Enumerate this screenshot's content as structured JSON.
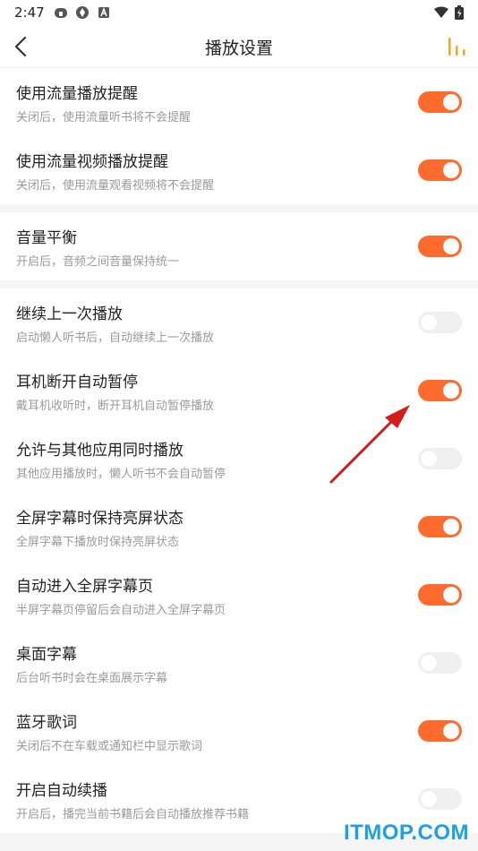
{
  "status_bar": {
    "time": "2:47",
    "left_icons": [
      "app-icon",
      "sync-icon",
      "a-badge-icon"
    ],
    "right_icons": [
      "wifi-icon",
      "battery-icon"
    ]
  },
  "header": {
    "title": "播放设置",
    "back_icon": "chevron-left-icon",
    "right_icon": "equalizer-icon"
  },
  "colors": {
    "accent": "#ff6b2c",
    "toggle_off": "#f0f0f0",
    "annotation_arrow": "#d41c1c"
  },
  "groups": [
    {
      "items": [
        {
          "title": "使用流量播放提醒",
          "subtitle": "关闭后，使用流量听书将不会提醒",
          "enabled": true
        },
        {
          "title": "使用流量视频播放提醒",
          "subtitle": "关闭后，使用流量观看视频将不会提醒",
          "enabled": true
        }
      ]
    },
    {
      "items": [
        {
          "title": "音量平衡",
          "subtitle": "开启后，音频之间音量保持统一",
          "enabled": true
        }
      ]
    },
    {
      "items": [
        {
          "title": "继续上一次播放",
          "subtitle": "启动懒人听书后，自动继续上一次播放",
          "enabled": false
        },
        {
          "title": "耳机断开自动暂停",
          "subtitle": "戴耳机收听时，断开耳机自动暂停播放",
          "enabled": true
        },
        {
          "title": "允许与其他应用同时播放",
          "subtitle": "其他应用播放时，懒人听书不会自动暂停",
          "enabled": false
        },
        {
          "title": "全屏字幕时保持亮屏状态",
          "subtitle": "全屏字幕下播放时保持亮屏状态",
          "enabled": true
        },
        {
          "title": "自动进入全屏字幕页",
          "subtitle": "半屏字幕页停留后会自动进入全屏字幕页",
          "enabled": true
        },
        {
          "title": "桌面字幕",
          "subtitle": "后台听书时会在桌面展示字幕",
          "enabled": false
        },
        {
          "title": "蓝牙歌词",
          "subtitle": "关闭后不在车载或通知栏中显示歌词",
          "enabled": true
        },
        {
          "title": "开启自动续播",
          "subtitle": "开启后，播完当前书籍后会自动播放推荐书籍",
          "enabled": false
        }
      ]
    }
  ],
  "watermark": "ITMOP.COM"
}
